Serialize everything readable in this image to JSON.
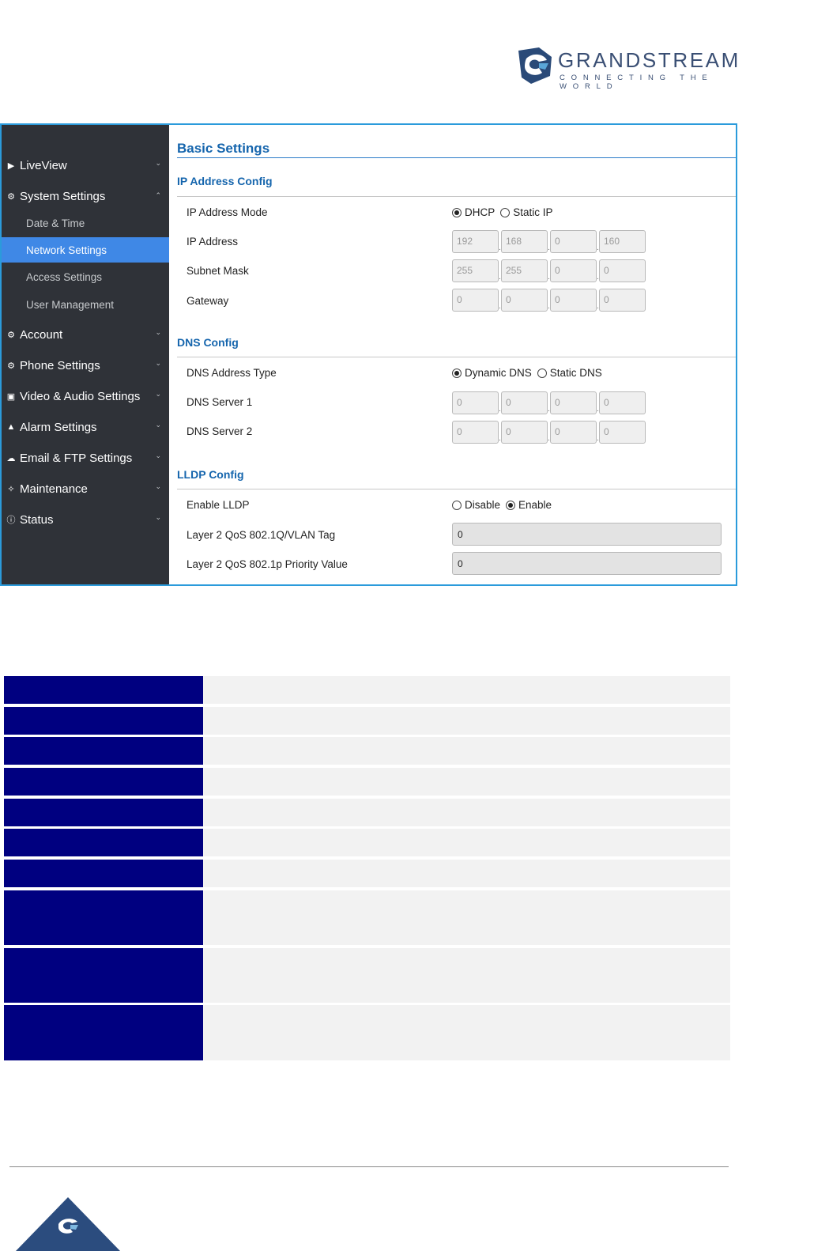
{
  "brand": {
    "name": "GRANDSTREAM",
    "tagline": "CONNECTING THE WORLD",
    "color": "#3a4f74",
    "accent": "#2b9bdb"
  },
  "sidebar": {
    "items": [
      {
        "label": "LiveView",
        "icon": "video-icon",
        "expanded": false
      },
      {
        "label": "System Settings",
        "icon": "gear-icon",
        "expanded": true,
        "children": [
          {
            "label": "Date & Time",
            "active": false
          },
          {
            "label": "Network Settings",
            "active": true
          },
          {
            "label": "Access Settings",
            "active": false
          },
          {
            "label": "User Management",
            "active": false
          }
        ]
      },
      {
        "label": "Account",
        "icon": "gear-icon",
        "expanded": false
      },
      {
        "label": "Phone Settings",
        "icon": "gear-icon",
        "expanded": false
      },
      {
        "label": "Video & Audio Settings",
        "icon": "camera-icon",
        "expanded": false
      },
      {
        "label": "Alarm Settings",
        "icon": "bell-icon",
        "expanded": false
      },
      {
        "label": "Email & FTP Settings",
        "icon": "cloud-icon",
        "expanded": false
      },
      {
        "label": "Maintenance",
        "icon": "wrench-icon",
        "expanded": false
      },
      {
        "label": "Status",
        "icon": "info-icon",
        "expanded": false
      }
    ]
  },
  "main": {
    "title": "Basic Settings",
    "ip_section": {
      "heading": "IP Address Config",
      "mode_label": "IP Address Mode",
      "mode_options": [
        "DHCP",
        "Static IP"
      ],
      "mode_selected": "DHCP",
      "ip_label": "IP Address",
      "ip": [
        "192",
        "168",
        "0",
        "160"
      ],
      "subnet_label": "Subnet Mask",
      "subnet": [
        "255",
        "255",
        "0",
        "0"
      ],
      "gateway_label": "Gateway",
      "gateway": [
        "0",
        "0",
        "0",
        "0"
      ]
    },
    "dns_section": {
      "heading": "DNS Config",
      "type_label": "DNS Address Type",
      "type_options": [
        "Dynamic DNS",
        "Static DNS"
      ],
      "type_selected": "Dynamic DNS",
      "dns1_label": "DNS Server 1",
      "dns1": [
        "0",
        "0",
        "0",
        "0"
      ],
      "dns2_label": "DNS Server 2",
      "dns2": [
        "0",
        "0",
        "0",
        "0"
      ]
    },
    "lldp_section": {
      "heading": "LLDP Config",
      "enable_label": "Enable LLDP",
      "enable_options": [
        "Disable",
        "Enable"
      ],
      "enable_selected": "Enable",
      "vlan_label": "Layer 2 QoS 802.1Q/VLAN Tag",
      "vlan_value": "0",
      "priority_label": "Layer 2 QoS 802.1p Priority Value",
      "priority_value": "0"
    }
  },
  "table": {
    "header_color": "#000080",
    "cell_color": "#f2f2f2",
    "row_count": 10
  }
}
